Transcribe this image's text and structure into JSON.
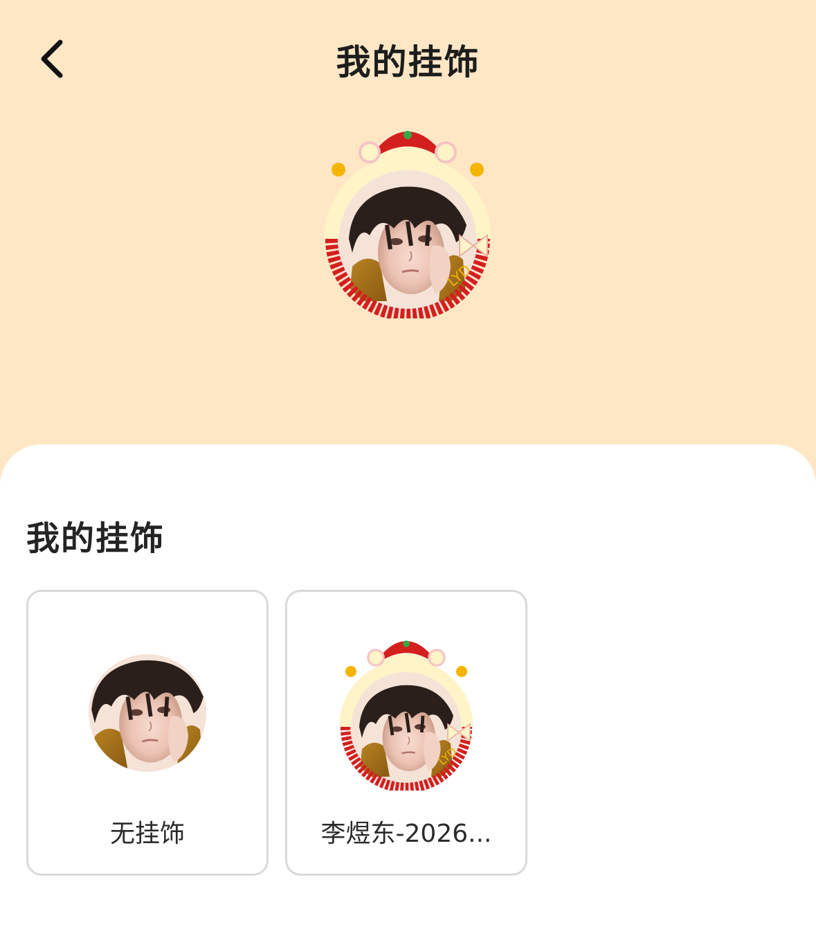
{
  "header": {
    "title": "我的挂饰",
    "back_icon": "chevron-left-icon"
  },
  "preview": {
    "avatar": "avatar-with-new-year-frame"
  },
  "section": {
    "title": "我的挂饰",
    "items": [
      {
        "label": "无挂饰",
        "avatar": "plain-avatar"
      },
      {
        "label": "李煜东-2026...",
        "avatar": "avatar-with-new-year-frame"
      }
    ]
  },
  "colors": {
    "header_bg": "#ffe7c6",
    "sheet_bg": "#ffffff",
    "frame_red": "#d41f1f",
    "frame_cream": "#fff3c8",
    "frame_gold": "#f4b400"
  }
}
